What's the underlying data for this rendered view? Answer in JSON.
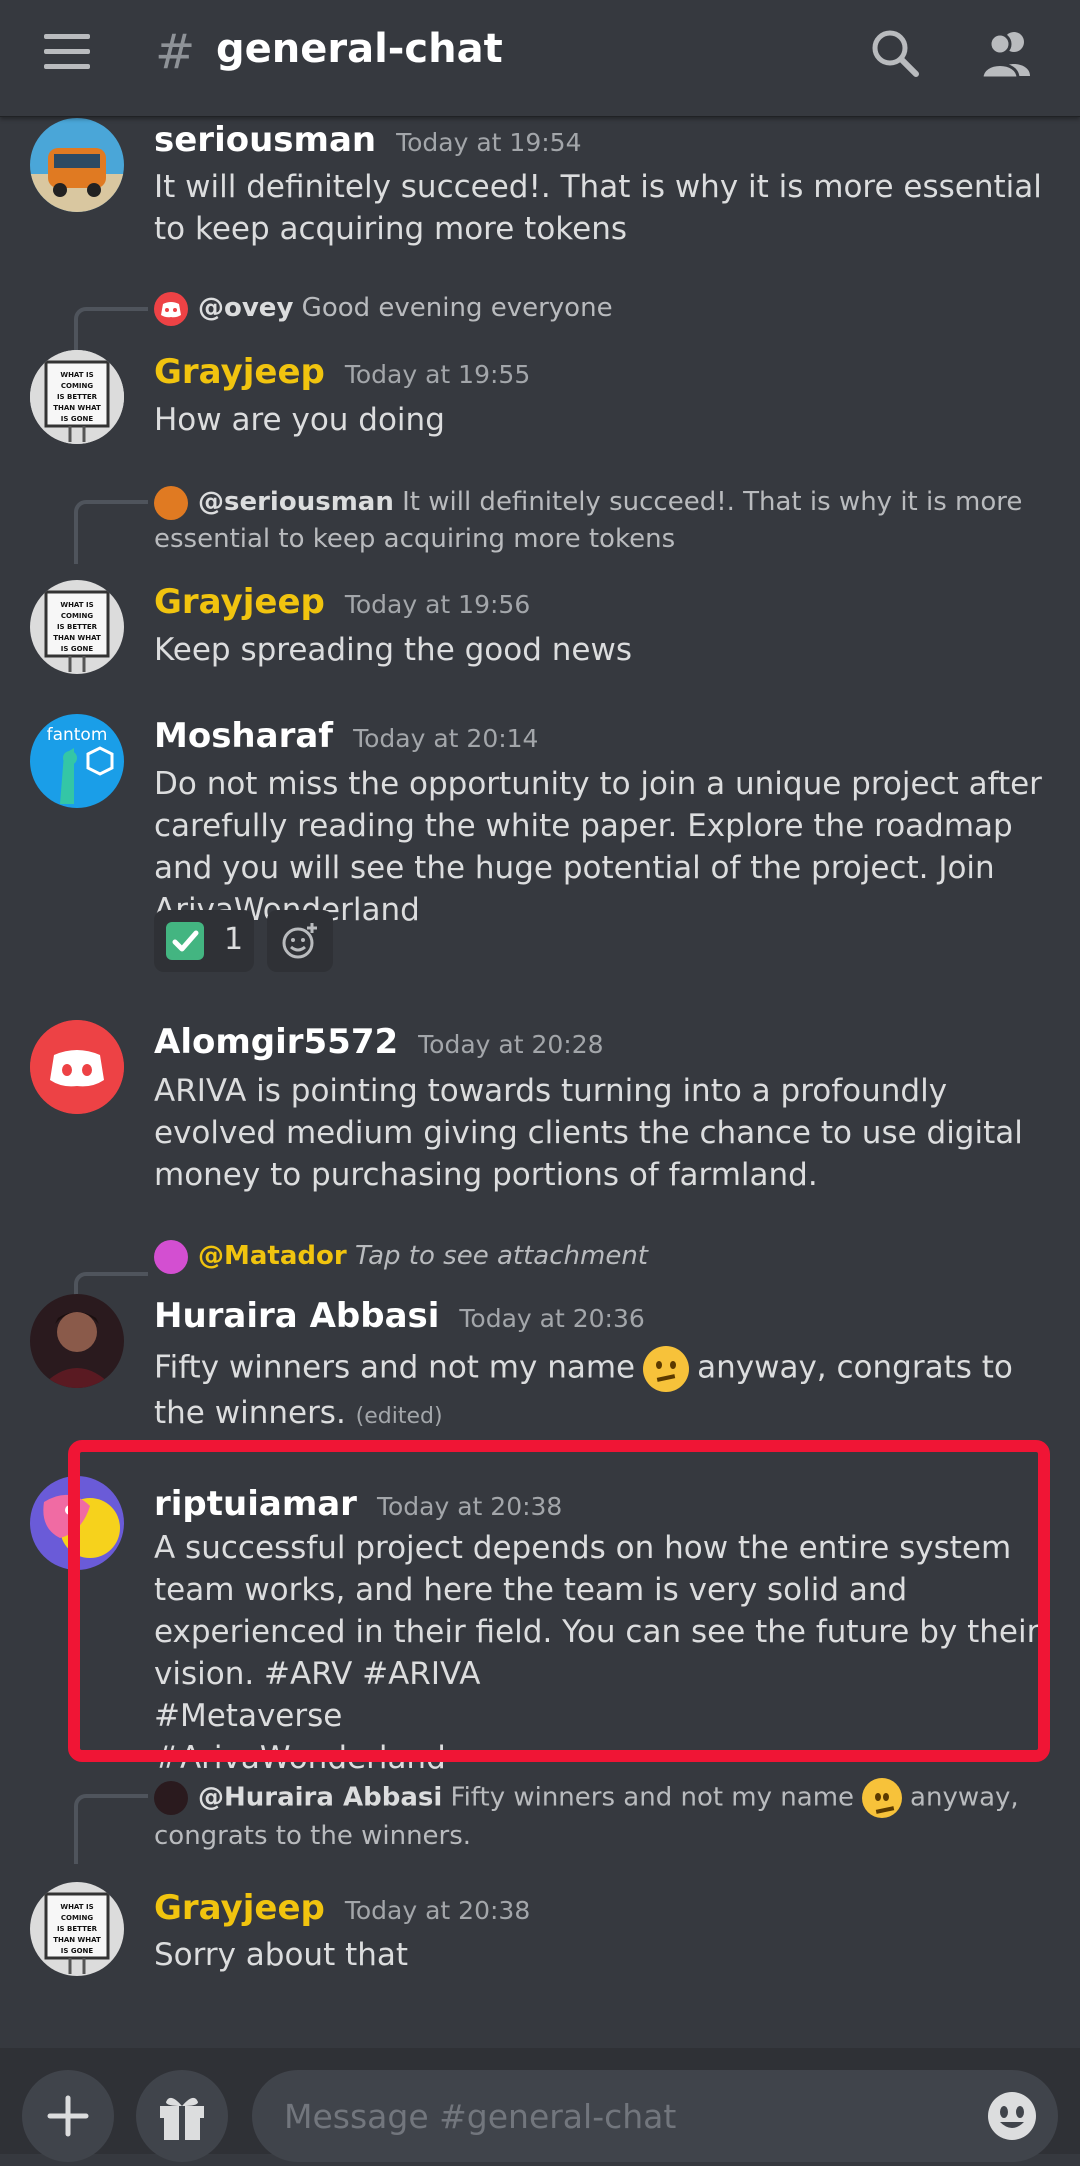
{
  "header": {
    "hash": "#",
    "channel": "general-chat"
  },
  "messages": [
    {
      "user": "seriousman",
      "time": "Today at 19:54",
      "text": "It will definitely succeed!. That is why it is more essential to keep acquiring more tokens"
    },
    {
      "reply_user": "@ovey",
      "reply_text": "Good evening everyone",
      "user": "Grayjeep",
      "time": "Today at 19:55",
      "text": "How are you doing"
    },
    {
      "reply_user": "@seriousman",
      "reply_text": "It will definitely succeed!. That is why it is more essential to keep acquiring more tokens",
      "user": "Grayjeep",
      "time": "Today at 19:56",
      "text": "Keep spreading the good news"
    },
    {
      "user": "Mosharaf",
      "time": "Today at 20:14",
      "text": "Do not miss the opportunity to join a unique project after carefully reading the white paper. Explore the roadmap and you will see the huge potential of the project. Join ArivaWonderland",
      "reaction_count": "1"
    },
    {
      "user": "Alomgir5572",
      "time": "Today at 20:28",
      "text": "ARIVA is pointing towards turning into a profoundly evolved medium giving clients the chance to use digital money to purchasing portions of farmland."
    },
    {
      "reply_user": "@Matador",
      "reply_text": "Tap to see attachment",
      "user": "Huraira Abbasi",
      "time": "Today at 20:36",
      "text_a": "Fifty winners and not my name",
      "text_b": "anyway, congrats to the winners.",
      "edited": "(edited)"
    },
    {
      "user": "riptuiamar",
      "time": "Today at 20:38",
      "text_a": "A successful project depends on how the entire system team works, and here the team is very solid and experienced in their field. You can see the future by their vision. #ARV #ARIVA",
      "text_b": "#Metaverse",
      "text_c": "#ArivaWonderland"
    },
    {
      "reply_user": "@Huraira Abbasi",
      "reply_text_a": "Fifty winners and not my name",
      "reply_text_b": "anyway, congrats to the winners.",
      "user": "Grayjeep",
      "time": "Today at 20:38",
      "text": "Sorry about that"
    }
  ],
  "avatar_text": {
    "grayjeep": "WHAT IS COMING IS BETTER THAN WHAT IS GONE",
    "fantom": "fantom"
  },
  "input": {
    "placeholder": "Message #general-chat"
  },
  "colors": {
    "background": "#36393f",
    "highlight": "#f01535",
    "gold": "#f1c40f",
    "discord_red": "#ed4245"
  }
}
